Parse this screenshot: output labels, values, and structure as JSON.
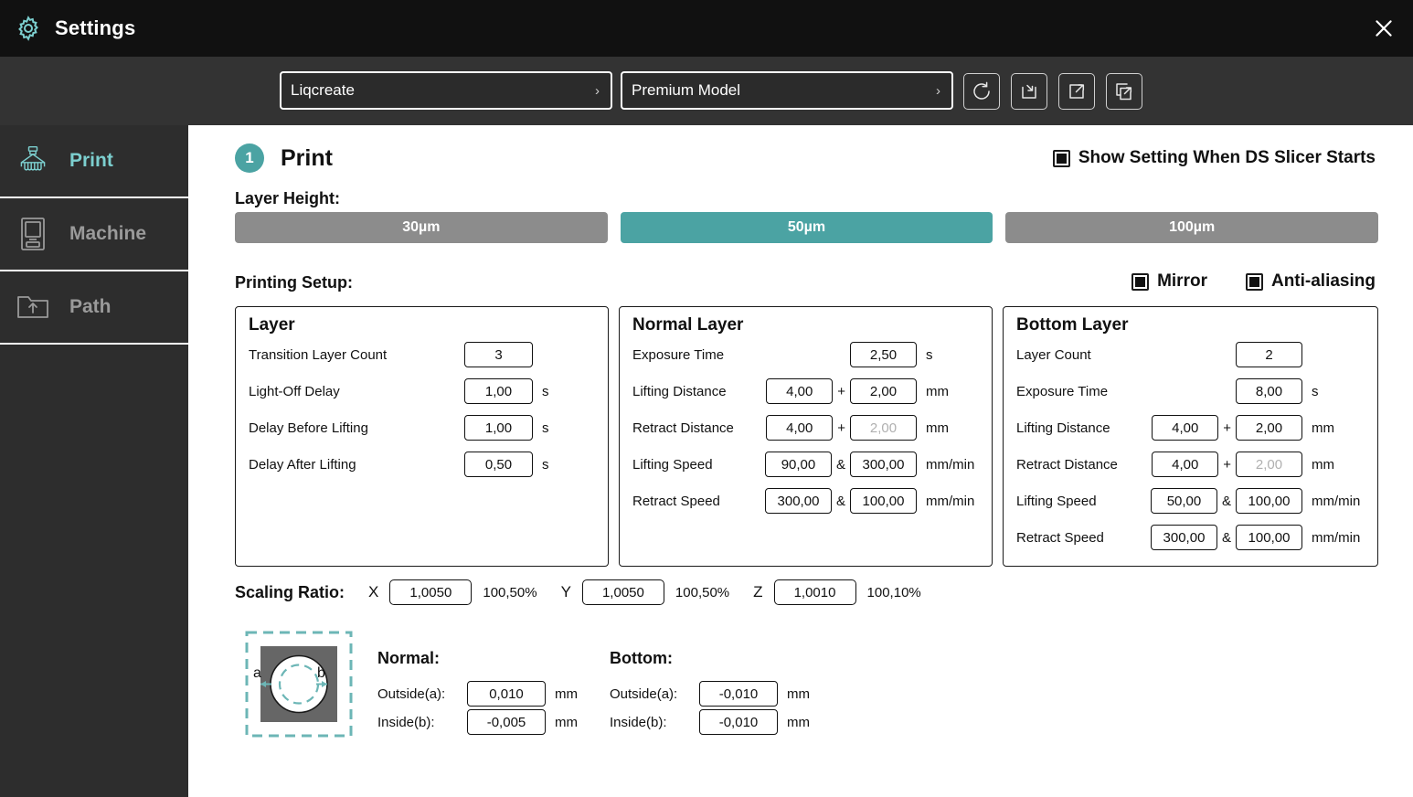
{
  "window": {
    "title": "Settings",
    "gear_icon": "gear-icon",
    "close_icon": "close-icon"
  },
  "toolbar": {
    "resin_profile": {
      "value": "Liqcreate",
      "chevron": "›"
    },
    "machine_profile": {
      "value": "Premium Model",
      "chevron": "›"
    },
    "buttons": [
      {
        "name": "reset-button",
        "icon": "reset-icon"
      },
      {
        "name": "import-button",
        "icon": "import-icon"
      },
      {
        "name": "export-button",
        "icon": "export-icon"
      },
      {
        "name": "export-all-button",
        "icon": "export-all-icon"
      }
    ]
  },
  "sidebar": {
    "items": [
      {
        "label": "Print",
        "icon": "printer-icon",
        "active": true
      },
      {
        "label": "Machine",
        "icon": "machine-icon",
        "active": false
      },
      {
        "label": "Path",
        "icon": "folder-upload-icon",
        "active": false
      }
    ]
  },
  "main": {
    "step_number": "1",
    "step_title": "Print",
    "show_setting": {
      "label": "Show Setting When DS Slicer Starts",
      "checked": true
    },
    "layer_height": {
      "label": "Layer Height:",
      "options": [
        "30µm",
        "50µm",
        "100µm"
      ],
      "selected_index": 1
    },
    "printing_setup": {
      "label": "Printing Setup:"
    },
    "mirror": {
      "label": "Mirror",
      "checked": true
    },
    "anti_aliasing": {
      "label": "Anti-aliasing",
      "checked": true
    },
    "layer_card": {
      "title": "Layer",
      "rows": [
        {
          "label": "Transition Layer Count",
          "value": "3",
          "unit": ""
        },
        {
          "label": "Light-Off Delay",
          "value": "1,00",
          "unit": "s"
        },
        {
          "label": "Delay Before Lifting",
          "value": "1,00",
          "unit": "s"
        },
        {
          "label": "Delay After Lifting",
          "value": "0,50",
          "unit": "s"
        }
      ]
    },
    "normal_card": {
      "title": "Normal Layer",
      "rows": [
        {
          "label": "Exposure Time",
          "value": "2,50",
          "unit": "s"
        },
        {
          "label": "Lifting Distance",
          "value": "4,00",
          "op": "+",
          "value2": "2,00",
          "unit": "mm"
        },
        {
          "label": "Retract Distance",
          "value": "4,00",
          "op": "+",
          "value2": "2,00",
          "value2_dim": true,
          "unit": "mm"
        },
        {
          "label": "Lifting Speed",
          "value": "90,00",
          "op": "&",
          "value2": "300,00",
          "unit": "mm/min"
        },
        {
          "label": "Retract Speed",
          "value": "300,00",
          "op": "&",
          "value2": "100,00",
          "unit": "mm/min"
        }
      ]
    },
    "bottom_card": {
      "title": "Bottom Layer",
      "rows": [
        {
          "label": "Layer Count",
          "value": "2",
          "unit": ""
        },
        {
          "label": "Exposure Time",
          "value": "8,00",
          "unit": "s"
        },
        {
          "label": "Lifting Distance",
          "value": "4,00",
          "op": "+",
          "value2": "2,00",
          "unit": "mm"
        },
        {
          "label": "Retract Distance",
          "value": "4,00",
          "op": "+",
          "value2": "2,00",
          "value2_dim": true,
          "unit": "mm"
        },
        {
          "label": "Lifting Speed",
          "value": "50,00",
          "op": "&",
          "value2": "100,00",
          "unit": "mm/min"
        },
        {
          "label": "Retract Speed",
          "value": "300,00",
          "op": "&",
          "value2": "100,00",
          "unit": "mm/min"
        }
      ]
    },
    "scaling_ratio": {
      "label": "Scaling Ratio:",
      "axes": [
        {
          "axis": "X",
          "value": "1,0050",
          "percent": "100,50%"
        },
        {
          "axis": "Y",
          "value": "1,0050",
          "percent": "100,50%"
        },
        {
          "axis": "Z",
          "value": "1,0010",
          "percent": "100,10%"
        }
      ]
    },
    "compensation": {
      "diagram": {
        "label_a": "a",
        "label_b": "b",
        "icon": "xy-compensation-diagram"
      },
      "normal": {
        "title": "Normal:",
        "outside": {
          "label": "Outside(a):",
          "value": "0,010",
          "unit": "mm"
        },
        "inside": {
          "label": "Inside(b):",
          "value": "-0,005",
          "unit": "mm"
        }
      },
      "bottom": {
        "title": "Bottom:",
        "outside": {
          "label": "Outside(a):",
          "value": "-0,010",
          "unit": "mm"
        },
        "inside": {
          "label": "Inside(b):",
          "value": "-0,010",
          "unit": "mm"
        }
      }
    }
  },
  "colors": {
    "accent": "#4ba3a3",
    "accent_light": "#7ccfcf",
    "titlebar_bg": "#111111",
    "toolbar_bg": "#333333",
    "sidebar_bg": "#2d2d2d",
    "inactive_button": "#8c8c8c"
  }
}
